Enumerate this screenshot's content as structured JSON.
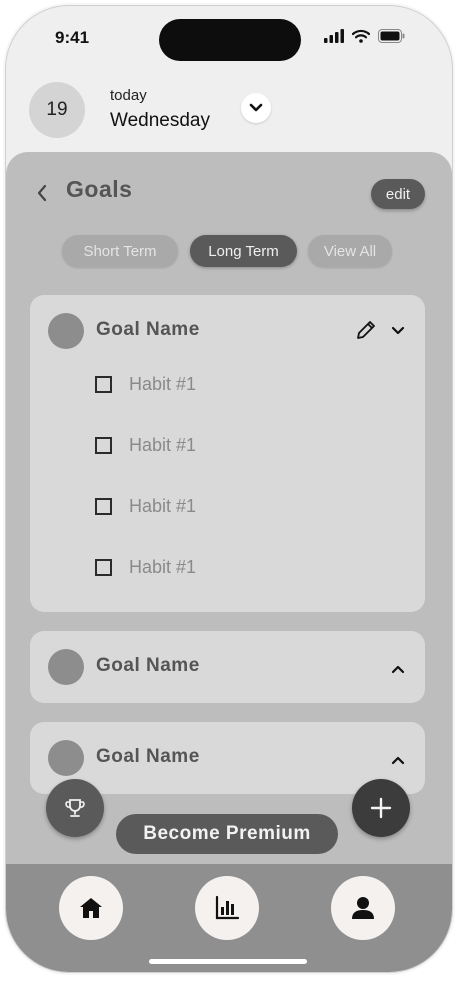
{
  "status_bar": {
    "time": "9:41"
  },
  "header": {
    "date_number": "19",
    "today_label": "today",
    "weekday": "Wednesday"
  },
  "goals_panel": {
    "title": "Goals",
    "edit_label": "edit",
    "tabs": [
      {
        "label": "Short Term",
        "selected": false
      },
      {
        "label": "Long Term",
        "selected": true
      },
      {
        "label": "View All",
        "selected": false
      }
    ],
    "goals": [
      {
        "name": "Goal Name",
        "expanded": true,
        "habits": [
          {
            "label": "Habit #1"
          },
          {
            "label": "Habit #1"
          },
          {
            "label": "Habit #1"
          },
          {
            "label": "Habit #1"
          }
        ]
      },
      {
        "name": "Goal Name",
        "expanded": false
      },
      {
        "name": "Goal Name",
        "expanded": false
      }
    ]
  },
  "premium_button": {
    "label": "Become Premium"
  },
  "bottom_nav": {
    "items": [
      {
        "icon": "home-icon"
      },
      {
        "icon": "bar-chart-icon"
      },
      {
        "icon": "profile-icon"
      }
    ]
  },
  "colors": {
    "panel": "#bdbdbd",
    "card": "#d9d9d9",
    "dark_button": "#5a5a5a",
    "nav_bar": "#8f8f8f"
  }
}
